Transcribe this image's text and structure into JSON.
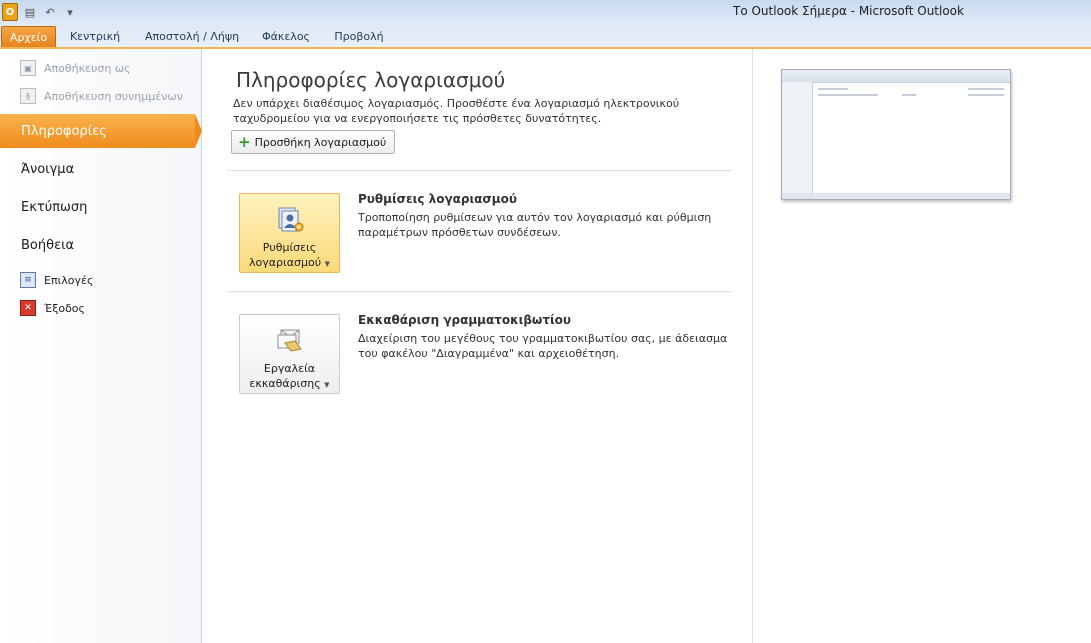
{
  "window": {
    "title": "Το Outlook Σήμερα  -  Microsoft Outlook"
  },
  "qat": {
    "app_icon": "outlook-icon",
    "save_icon": "save-icon",
    "undo_icon": "undo-icon",
    "customize_icon": "customize-qat-icon"
  },
  "tabs": [
    {
      "label": "Αρχείο"
    },
    {
      "label": "Κεντρική"
    },
    {
      "label": "Αποστολή / Λήψη"
    },
    {
      "label": "Φάκελος"
    },
    {
      "label": "Προβολή"
    }
  ],
  "sidebar": {
    "save_as": "Αποθήκευση ως",
    "save_attachments": "Αποθήκευση συνημμένων",
    "info": "Πληροφορίες",
    "open": "Άνοιγμα",
    "print": "Εκτύπωση",
    "help": "Βοήθεια",
    "options": "Επιλογές",
    "exit": "Έξοδος"
  },
  "main": {
    "title": "Πληροφορίες λογαριασμού",
    "description": "Δεν υπάρχει διαθέσιμος λογαριασμός. Προσθέστε ένα λογαριασμό ηλεκτρονικού ταχυδρομείου για να ενεργοποιήσετε τις πρόσθετες δυνατότητες.",
    "add_account": "Προσθήκη λογαριασμού",
    "sections": [
      {
        "button_line1": "Ρυθμίσεις",
        "button_line2": "λογαριασμού",
        "title": "Ρυθμίσεις λογαριασμού",
        "description": "Τροποποίηση ρυθμίσεων για αυτόν τον λογαριασμό και ρύθμιση παραμέτρων πρόσθετων συνδέσεων."
      },
      {
        "button_line1": "Εργαλεία",
        "button_line2": "εκκαθάρισης",
        "title": "Εκκαθάριση γραμματοκιβωτίου",
        "description": "Διαχείριση του μεγέθους του γραμματοκιβωτίου σας, με άδειασμα του φακέλου \"Διαγραμμένα\" και αρχειοθέτηση."
      }
    ]
  },
  "colors": {
    "accent": "#f08c1c",
    "ribbon": "#dfe8f4",
    "highlight": "#fbd97a"
  }
}
